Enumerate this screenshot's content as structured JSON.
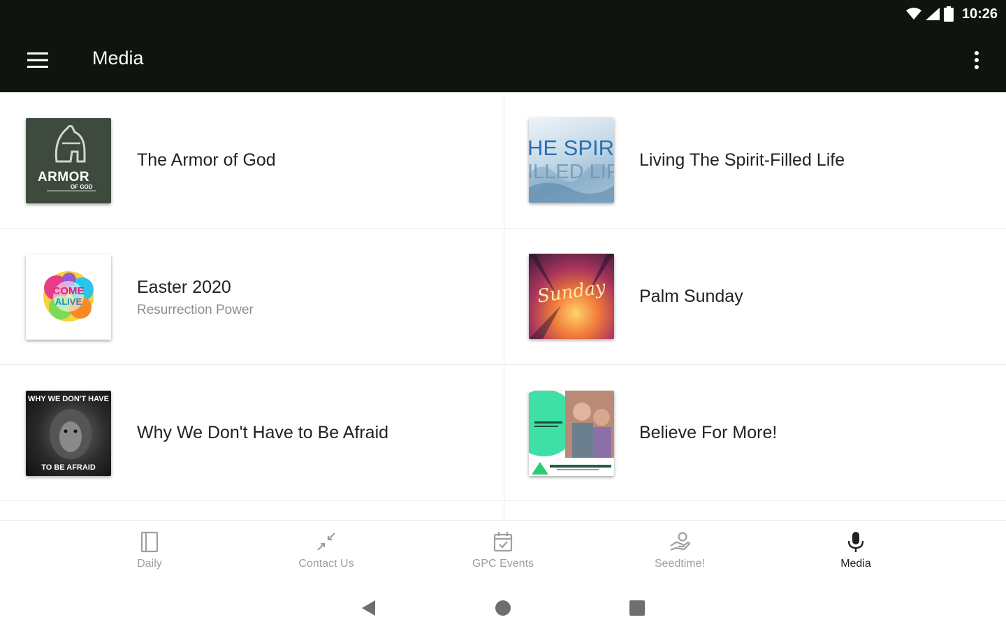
{
  "status_bar": {
    "time": "10:26"
  },
  "app_bar": {
    "title": "Media"
  },
  "items": [
    {
      "title": "The Armor of God",
      "subtitle": "",
      "thumb_text": [
        "ARMOR",
        "OF GOD"
      ]
    },
    {
      "title": "Living The Spirit-Filled Life",
      "subtitle": "",
      "thumb_text": [
        "HE SPIR",
        "ILLED LIF"
      ]
    },
    {
      "title": "Easter 2020",
      "subtitle": "Resurrection Power",
      "thumb_text": [
        "COME",
        "ALIVE"
      ]
    },
    {
      "title": "Palm Sunday",
      "subtitle": "",
      "thumb_text": [
        "Sunday"
      ]
    },
    {
      "title": "Why We Don't Have to Be Afraid",
      "subtitle": "",
      "thumb_text": [
        "WHY WE DON'T HAVE",
        "TO BE AFRAID"
      ]
    },
    {
      "title": "Believe For More!",
      "subtitle": "",
      "thumb_text": []
    }
  ],
  "bottom_nav": [
    {
      "label": "Daily",
      "icon": "book-icon",
      "active": false
    },
    {
      "label": "Contact Us",
      "icon": "arrows-in-icon",
      "active": false
    },
    {
      "label": "GPC Events",
      "icon": "calendar-check-icon",
      "active": false
    },
    {
      "label": "Seedtime!",
      "icon": "hand-heart-icon",
      "active": false
    },
    {
      "label": "Media",
      "icon": "microphone-icon",
      "active": true
    }
  ],
  "colors": {
    "app_bar": "#0f140f",
    "nav_inactive": "#9e9e9e",
    "nav_active": "#222222"
  }
}
